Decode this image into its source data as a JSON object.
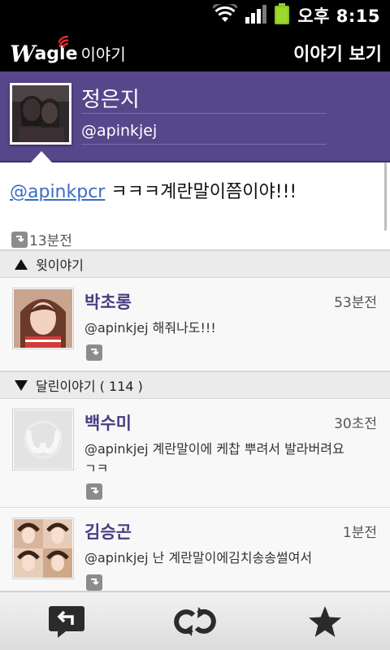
{
  "status_bar": {
    "time": "오후 8:15"
  },
  "app_bar": {
    "logo_w": "W",
    "logo_agle": "agle",
    "logo_ko": "이야기",
    "title": "이야기 보기"
  },
  "profile": {
    "name": "정은지",
    "handle": "@apinkjej"
  },
  "message": {
    "mention": "@apinkpcr",
    "text": " ㅋㅋㅋ계란말이쯤이야!!!",
    "time": "13분전"
  },
  "upper_section": {
    "label": "윗이야기"
  },
  "upper_items": [
    {
      "name": "박초롱",
      "time": "53분전",
      "text": "@apinkjej 해줘나도!!!"
    }
  ],
  "replies_section": {
    "label": "달린이야기 ( 114 )"
  },
  "replies": [
    {
      "name": "백수미",
      "time": "30초전",
      "text": "@apinkjej 계란말이에 케찹 뿌려서 발라버려요ㄱㅋ"
    },
    {
      "name": "김승곤",
      "time": "1분전",
      "text": "@apinkjej 난 계란말이에김치송송썰여서"
    }
  ],
  "bottom_bar": {
    "icons": [
      "reply-icon",
      "retweet-icon",
      "star-icon"
    ]
  },
  "colors": {
    "accent": "#56468a",
    "name": "#4a3d82",
    "mention": "#3a6cc4"
  }
}
